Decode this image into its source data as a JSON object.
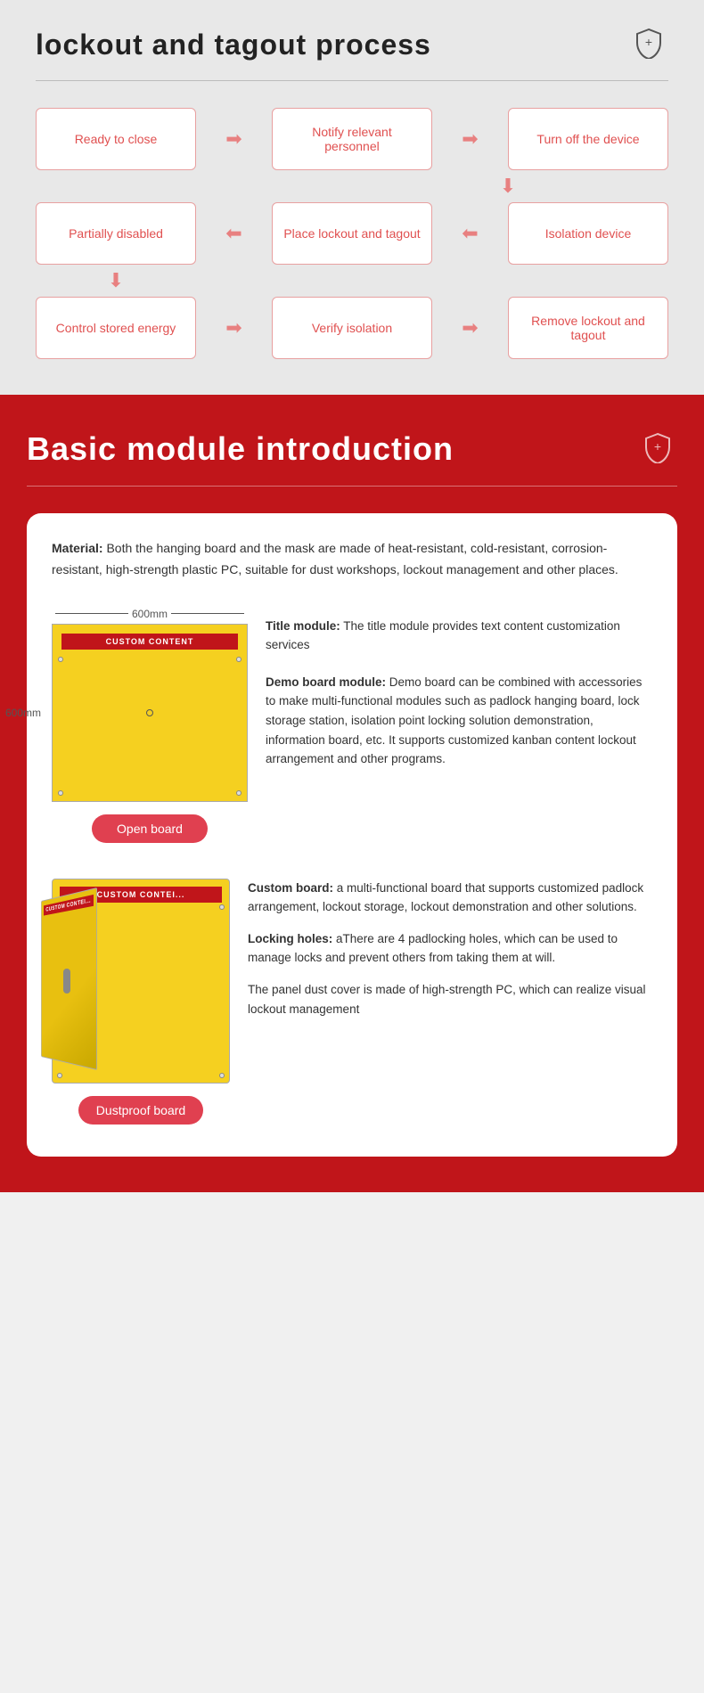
{
  "section1": {
    "title": "lockout and tagout process",
    "divider": true,
    "flow": {
      "row1": [
        {
          "label": "Ready to close"
        },
        {
          "arrow": "→"
        },
        {
          "label": "Notify relevant personnel"
        },
        {
          "arrow": "→"
        },
        {
          "label": "Turn off the device"
        }
      ],
      "row2_arrows": [
        "",
        "",
        "",
        "",
        "↓"
      ],
      "row3": [
        {
          "label": "Partially disabled"
        },
        {
          "arrow": "←"
        },
        {
          "label": "Place lockout and tagout"
        },
        {
          "arrow": "←"
        },
        {
          "label": "Isolation device"
        }
      ],
      "row4_arrows": [
        "↓",
        "",
        "",
        "",
        ""
      ],
      "row5": [
        {
          "label": "Control stored energy"
        },
        {
          "arrow": "→"
        },
        {
          "label": "Verify isolation"
        },
        {
          "arrow": "→"
        },
        {
          "label": "Remove lockout and tagout"
        }
      ]
    }
  },
  "section2": {
    "title": "Basic module introduction",
    "card": {
      "material_label": "Material:",
      "material_text": " Both the hanging board and the mask are made of heat-resistant, cold-resistant, corrosion-resistant, high-strength plastic PC, suitable for dust workshops, lockout management and other places.",
      "board1": {
        "dimension_top": "600mm",
        "dimension_side": "600mm",
        "custom_content_label": "CUSTOM CONTENT",
        "open_board_btn": "Open board",
        "title_module_label": "Title module:",
        "title_module_text": " The title module provides text content customization services",
        "demo_board_label": "Demo board module:",
        "demo_board_text": " Demo board can be combined with accessories to make multi-functional modules such as padlock hanging board, lock storage station, isolation point locking solution demonstration, information board, etc. It supports customized kanban content lockout arrangement and other programs."
      },
      "board2": {
        "custom_content_label": "CUSTOM CONTEI...",
        "dustproof_board_btn": "Dustproof board",
        "custom_board_label": "Custom board:",
        "custom_board_text": " a multi-functional board that supports customized padlock arrangement, lockout storage, lockout demonstration and other solutions.",
        "locking_holes_label": "Locking holes:",
        "locking_holes_text": " aThere are 4 padlocking holes, which can be used to manage locks and prevent others from taking them at will.",
        "panel_text": "The panel dust cover is made of high-strength PC, which can realize visual lockout management"
      }
    }
  }
}
